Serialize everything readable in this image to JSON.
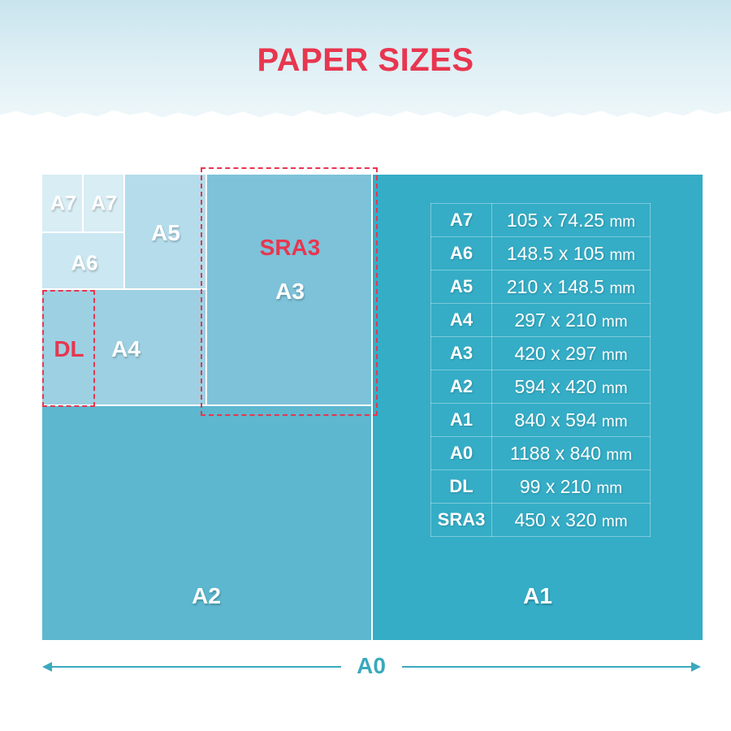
{
  "title": "PAPER SIZES",
  "colors": {
    "title": "#e8364f",
    "accent_red": "#e8364f",
    "arrow": "#3aa9bd",
    "header_wash": "#d6ecf2",
    "a0": "#35adc6",
    "a2": "#5cb7cf",
    "a3": "#7dc2d9",
    "a4": "#9dd0e2",
    "a5": "#b4dceb",
    "a6": "#cbe7f1",
    "a7": "#d9edf4"
  },
  "diagram": {
    "labels": {
      "a7_left": "A7",
      "a7_right": "A7",
      "a6": "A6",
      "a5": "A5",
      "dl": "DL",
      "a4": "A4",
      "sra3": "SRA3",
      "a3": "A3",
      "a2": "A2",
      "a1": "A1",
      "a0": "A0"
    }
  },
  "size_table": [
    {
      "name": "A7",
      "width": "105",
      "height": "74.25",
      "unit": "mm"
    },
    {
      "name": "A6",
      "width": "148.5",
      "height": "105",
      "unit": "mm"
    },
    {
      "name": "A5",
      "width": "210",
      "height": "148.5",
      "unit": "mm"
    },
    {
      "name": "A4",
      "width": "297",
      "height": "210",
      "unit": "mm"
    },
    {
      "name": "A3",
      "width": "420",
      "height": "297",
      "unit": "mm"
    },
    {
      "name": "A2",
      "width": "594",
      "height": "420",
      "unit": "mm"
    },
    {
      "name": "A1",
      "width": "840",
      "height": "594",
      "unit": "mm"
    },
    {
      "name": "A0",
      "width": "1188",
      "height": "840",
      "unit": "mm"
    },
    {
      "name": "DL",
      "width": "99",
      "height": "210",
      "unit": "mm"
    },
    {
      "name": "SRA3",
      "width": "450",
      "height": "320",
      "unit": "mm"
    }
  ],
  "dimension_separator": "x"
}
